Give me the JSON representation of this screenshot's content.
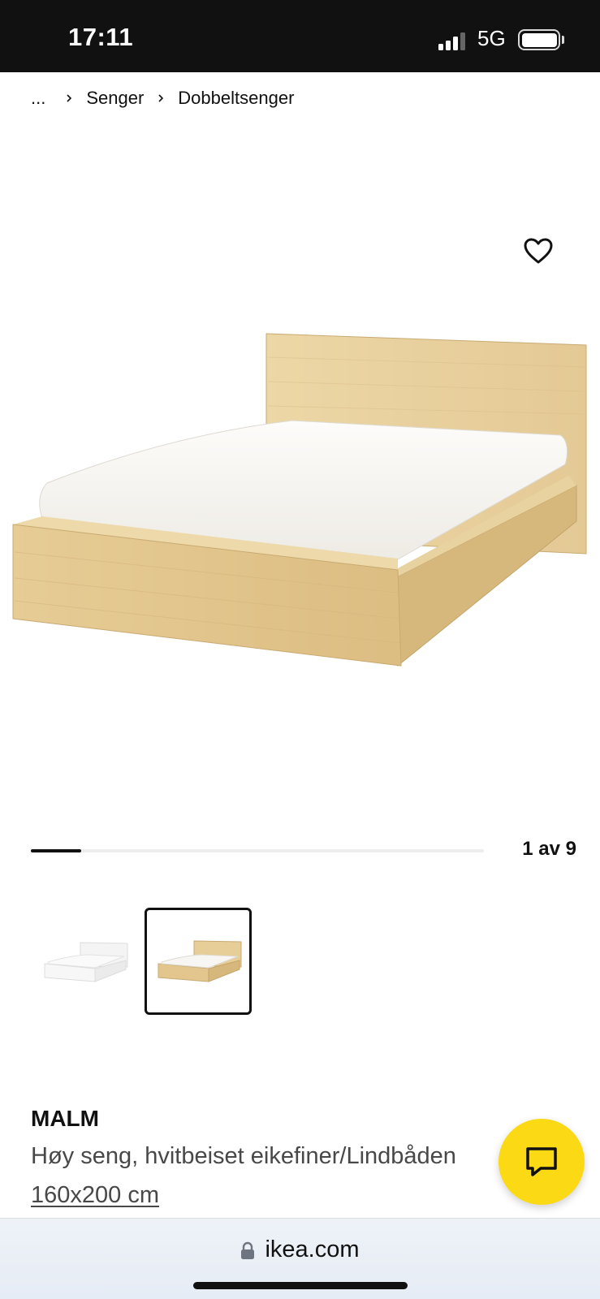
{
  "status_bar": {
    "time": "17:11",
    "network": "5G",
    "icons": [
      "signal-icon",
      "battery-icon"
    ]
  },
  "breadcrumb": {
    "ellipsis": "...",
    "items": [
      {
        "label": "Senger"
      },
      {
        "label": "Dobbeltsenger"
      }
    ],
    "separator_icon": "chevron-right-icon"
  },
  "gallery": {
    "favorite_icon": "heart-outline-icon",
    "current": 1,
    "total": 9,
    "counter_label": "1 av 9",
    "progress_fraction": 0.111,
    "thumbnails": [
      {
        "name": "white-bed-thumbnail",
        "selected": false
      },
      {
        "name": "oak-bed-thumbnail",
        "selected": true
      }
    ]
  },
  "product": {
    "name": "MALM",
    "description": "Høy seng, hvitbeiset eikefiner/Lindbåden",
    "size": "160x200 cm"
  },
  "chat": {
    "icon": "chat-bubble-icon",
    "color": "#fbd914"
  },
  "browser": {
    "url": "ikea.com",
    "lock_icon": "lock-icon"
  }
}
